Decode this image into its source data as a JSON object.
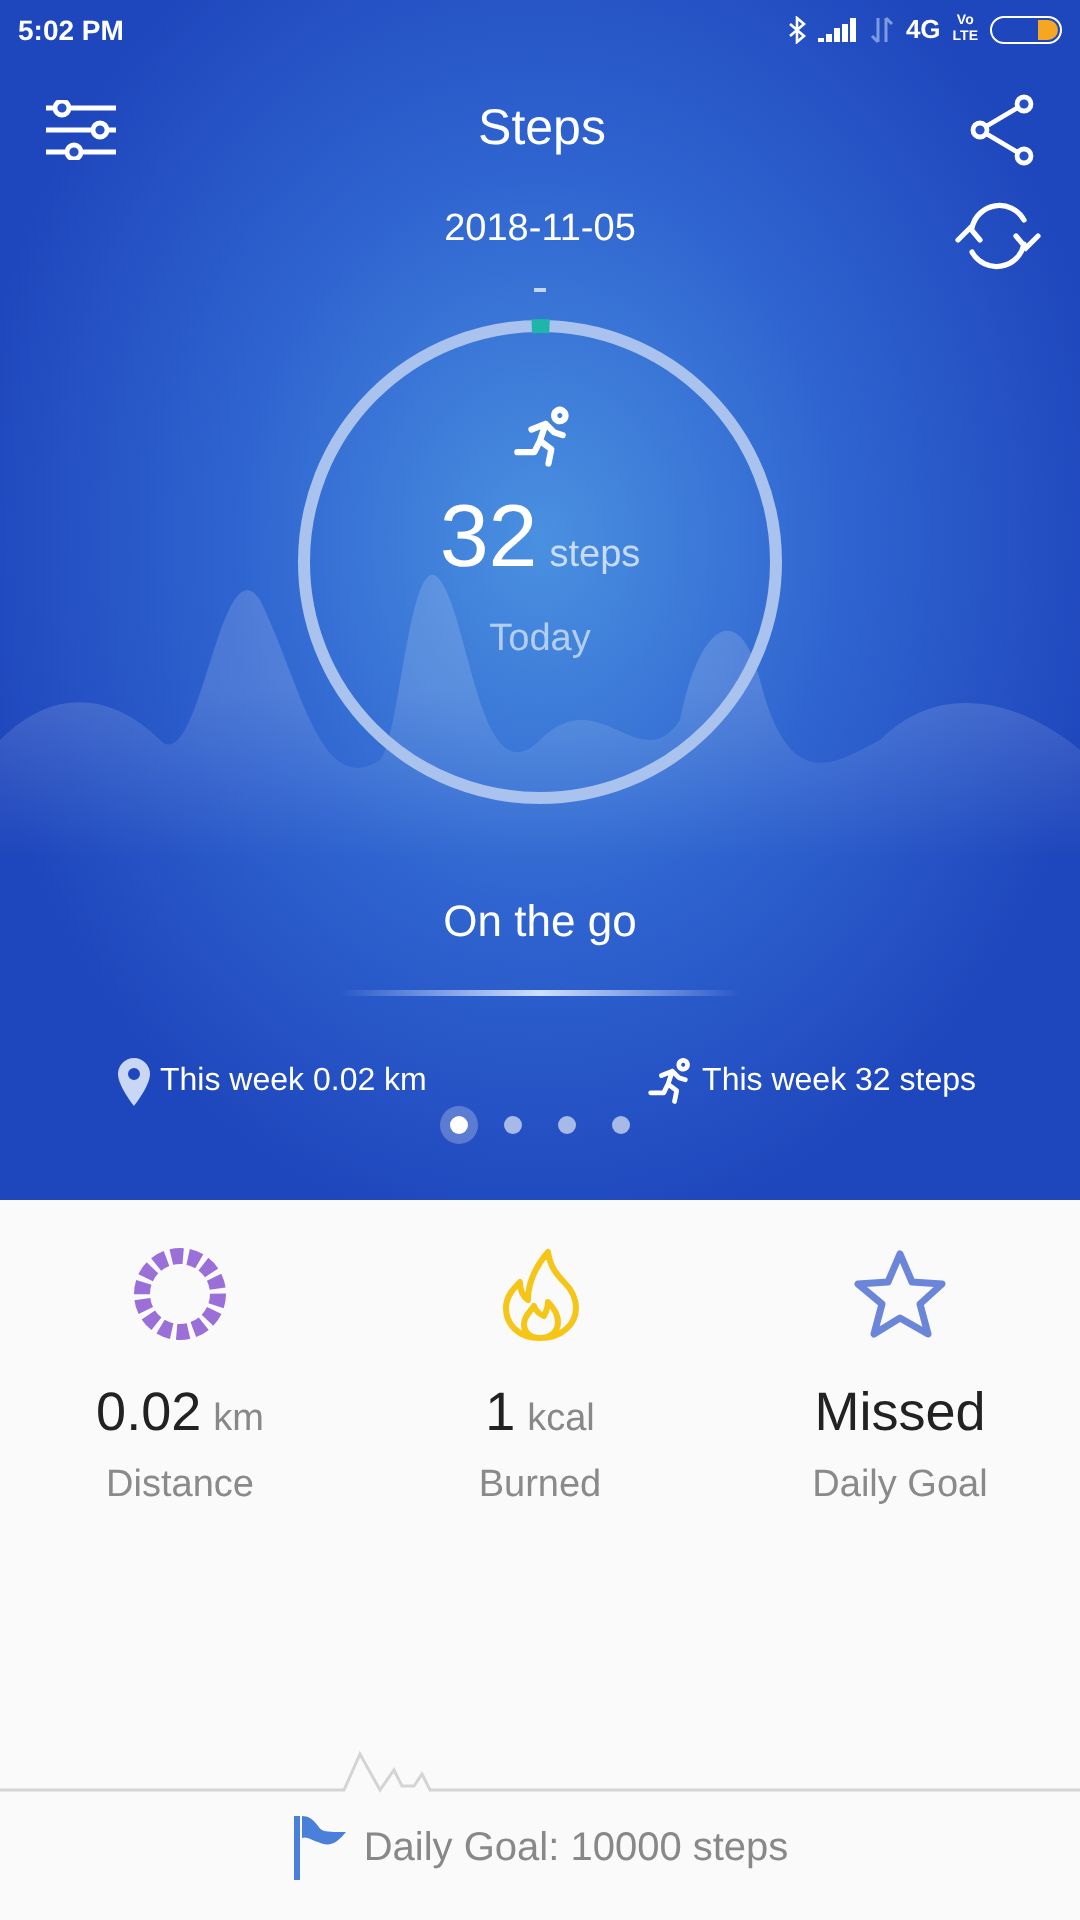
{
  "status_bar": {
    "time": "5:02 PM",
    "network": "4G",
    "volte": [
      "Vo",
      "LTE"
    ]
  },
  "header": {
    "title": "Steps",
    "date": "2018-11-05"
  },
  "ring": {
    "level": 0.0032,
    "value": "32",
    "unit": "steps",
    "caption": "Today"
  },
  "status_text": "On the go",
  "weekly": [
    {
      "kind": "distance",
      "text": "This week 0.02 km"
    },
    {
      "kind": "steps",
      "text": "This week 32 steps"
    }
  ],
  "pages": [
    {
      "selected": true
    },
    {
      "selected": false
    },
    {
      "selected": false
    },
    {
      "selected": false
    }
  ],
  "stats": [
    {
      "kind": "distance",
      "value": "0.02",
      "unit": "km",
      "label": "Distance"
    },
    {
      "kind": "calories",
      "value": "1",
      "unit": "kcal",
      "label": "Burned"
    },
    {
      "kind": "goal",
      "value": "Missed",
      "label": "Daily Goal"
    }
  ],
  "footer": {
    "text": "Daily Goal: 10000 steps"
  }
}
